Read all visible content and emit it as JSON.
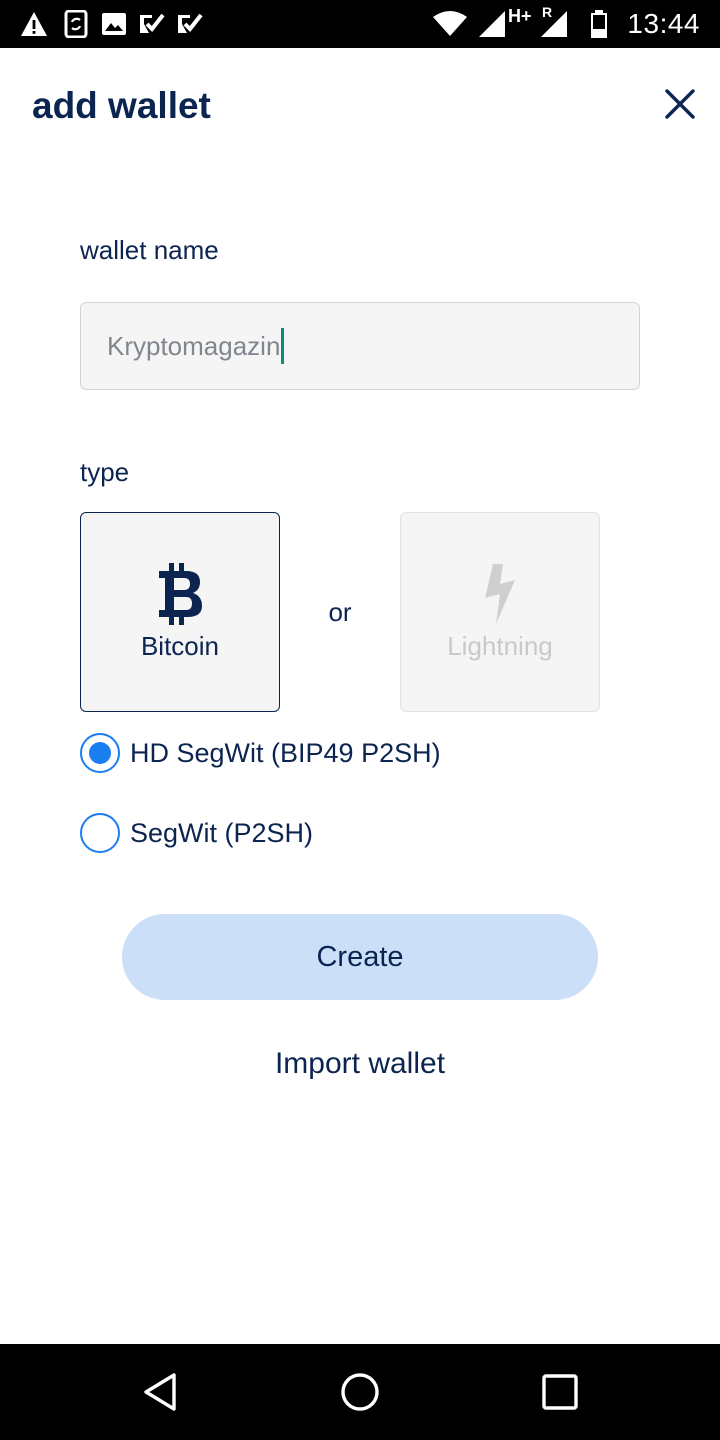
{
  "status_bar": {
    "time": "13:44",
    "icons": [
      "warning-icon",
      "phone-sync-icon",
      "image-icon",
      "check-badge-icon",
      "check-badge-icon",
      "wifi-icon",
      "signal-icon",
      "signal-roaming-icon",
      "battery-icon"
    ],
    "network_type": "H+",
    "roaming": "R"
  },
  "header": {
    "title": "add wallet",
    "close_icon": "close-icon"
  },
  "form": {
    "name_label": "wallet name",
    "name_value": "Kryptomagazin",
    "type_label": "type",
    "or_text": "or",
    "types": [
      {
        "label": "Bitcoin",
        "icon": "bitcoin-icon",
        "selected": true
      },
      {
        "label": "Lightning",
        "icon": "lightning-icon",
        "selected": false
      }
    ],
    "options": [
      {
        "label": "HD SegWit (BIP49 P2SH)",
        "checked": true
      },
      {
        "label": "SegWit (P2SH)",
        "checked": false
      }
    ],
    "create_label": "Create",
    "import_label": "Import wallet"
  },
  "nav_bar": {
    "icons": [
      "back-icon",
      "home-icon",
      "recents-icon"
    ]
  },
  "colors": {
    "primary_text": "#0c2550",
    "radio_accent": "#1a7ef0",
    "create_button_bg": "#ccdff8",
    "caret": "#0f8a7e"
  }
}
